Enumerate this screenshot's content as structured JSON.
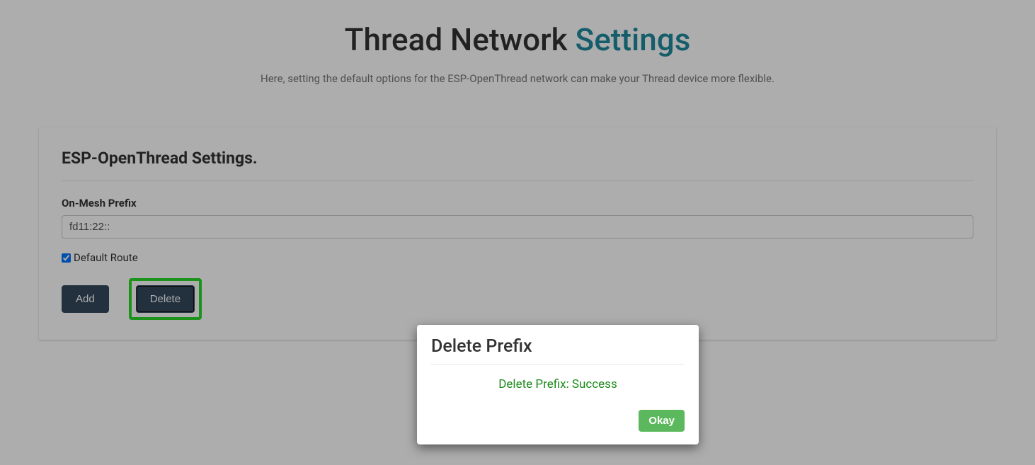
{
  "header": {
    "title_prefix": "Thread Network ",
    "title_accent": "Settings",
    "subtitle": "Here, setting the default options for the ESP-OpenThread network can make your Thread device more flexible."
  },
  "card": {
    "heading": "ESP-OpenThread Settings.",
    "prefix_label": "On-Mesh Prefix",
    "prefix_value": "fd11:22::",
    "default_route_label": "Default Route",
    "default_route_checked": true,
    "add_label": "Add",
    "delete_label": "Delete"
  },
  "modal": {
    "title": "Delete Prefix",
    "message": "Delete Prefix: Success",
    "okay_label": "Okay"
  }
}
